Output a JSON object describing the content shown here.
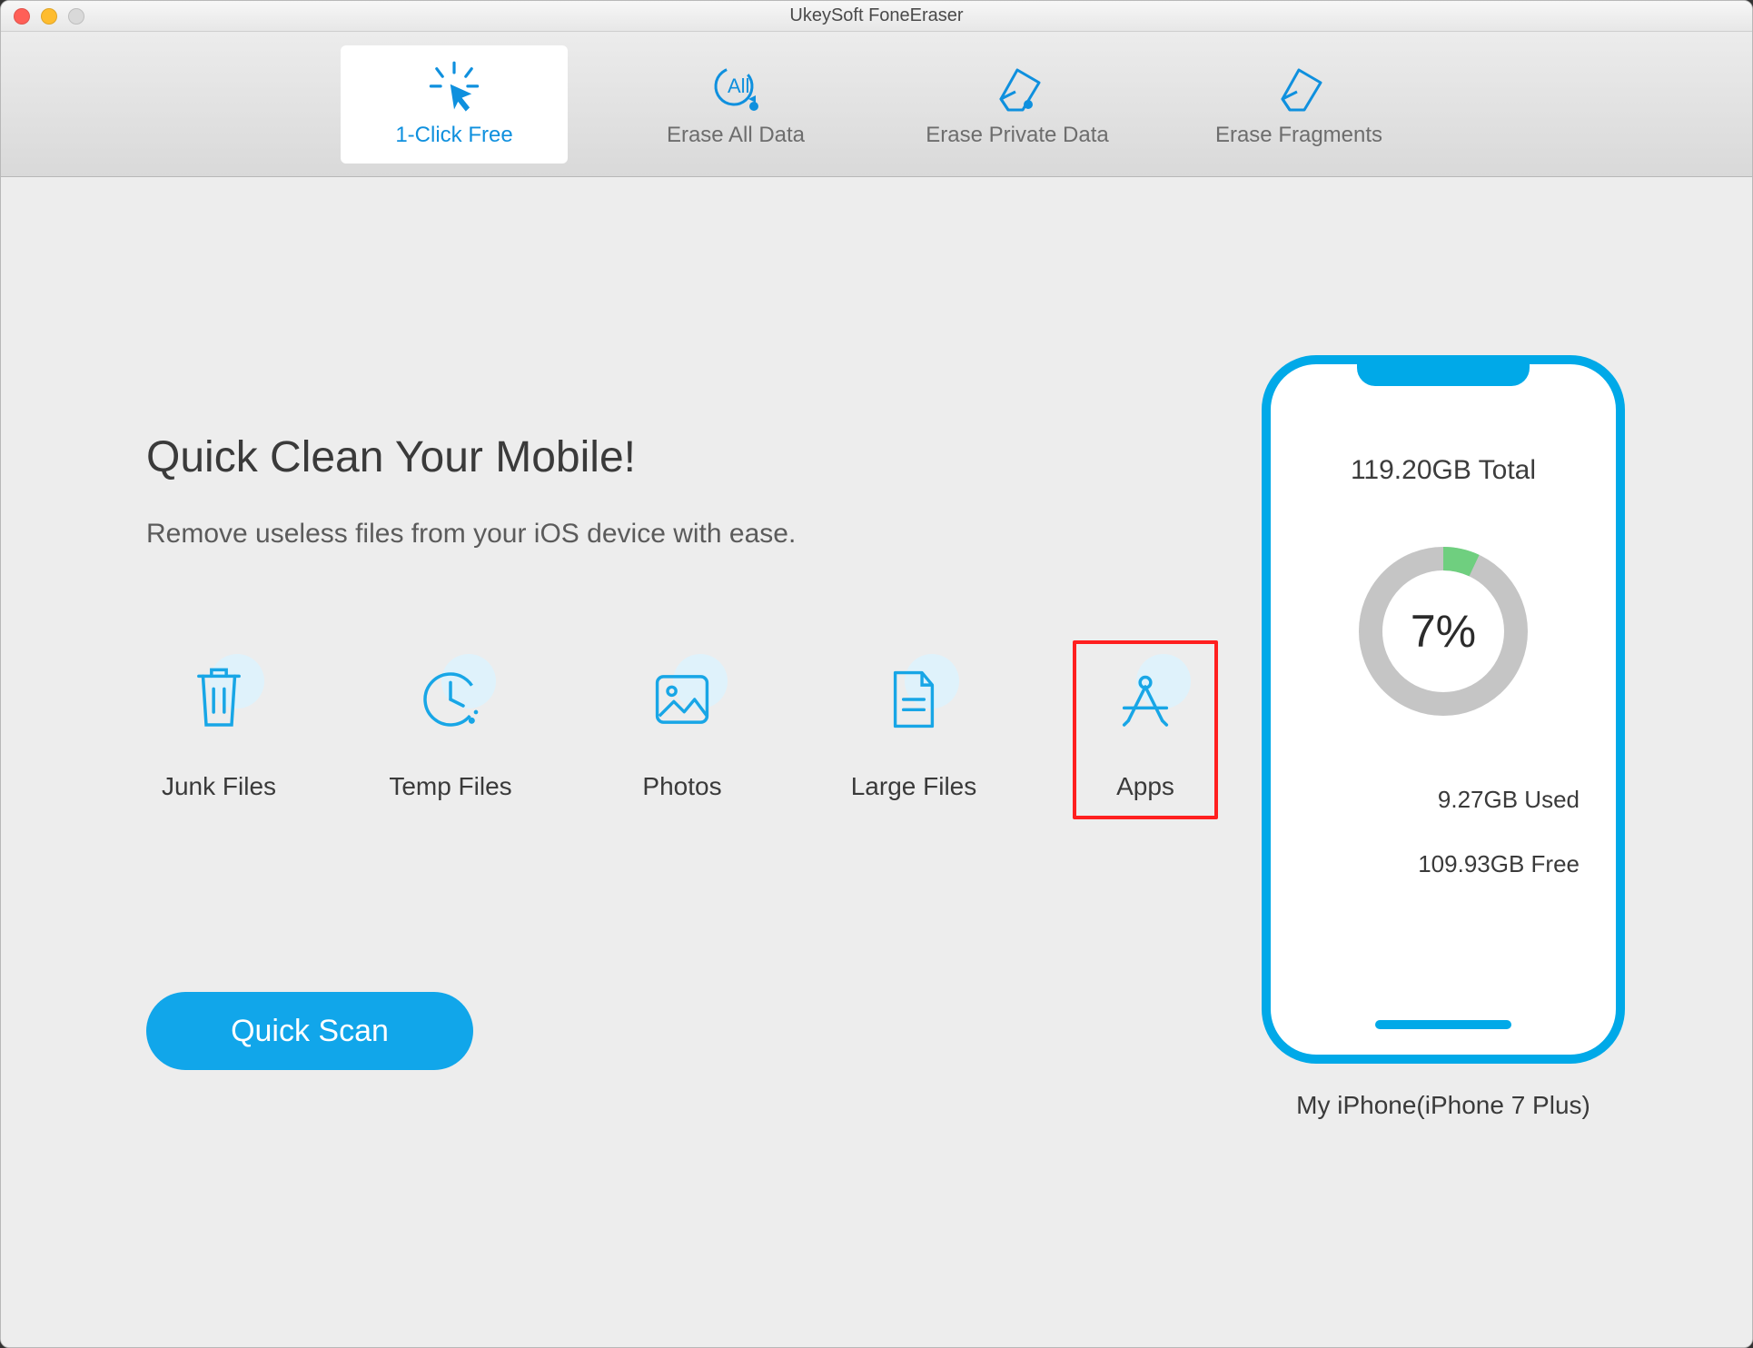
{
  "window_title": "UkeySoft FoneEraser",
  "tabs": [
    {
      "label": "1-Click Free",
      "active": true
    },
    {
      "label": "Erase All Data",
      "active": false
    },
    {
      "label": "Erase Private Data",
      "active": false
    },
    {
      "label": "Erase Fragments",
      "active": false
    }
  ],
  "headline": "Quick Clean Your Mobile!",
  "subhead": "Remove useless files from your iOS device with ease.",
  "categories": [
    {
      "label": "Junk Files"
    },
    {
      "label": "Temp Files"
    },
    {
      "label": "Photos"
    },
    {
      "label": "Large Files"
    },
    {
      "label": "Apps",
      "highlighted": true
    }
  ],
  "scan_button": "Quick Scan",
  "device": {
    "total": "119.20GB Total",
    "used_pct": "7%",
    "used_pct_value": 7,
    "used": "9.27GB Used",
    "free": "109.93GB Free",
    "name": "My iPhone(iPhone 7 Plus)"
  },
  "colors": {
    "accent": "#00a9e8",
    "ring_bg": "#c5c5c5",
    "ring_used": "#6fcf7f",
    "highlight_border": "#ff1f1f"
  }
}
